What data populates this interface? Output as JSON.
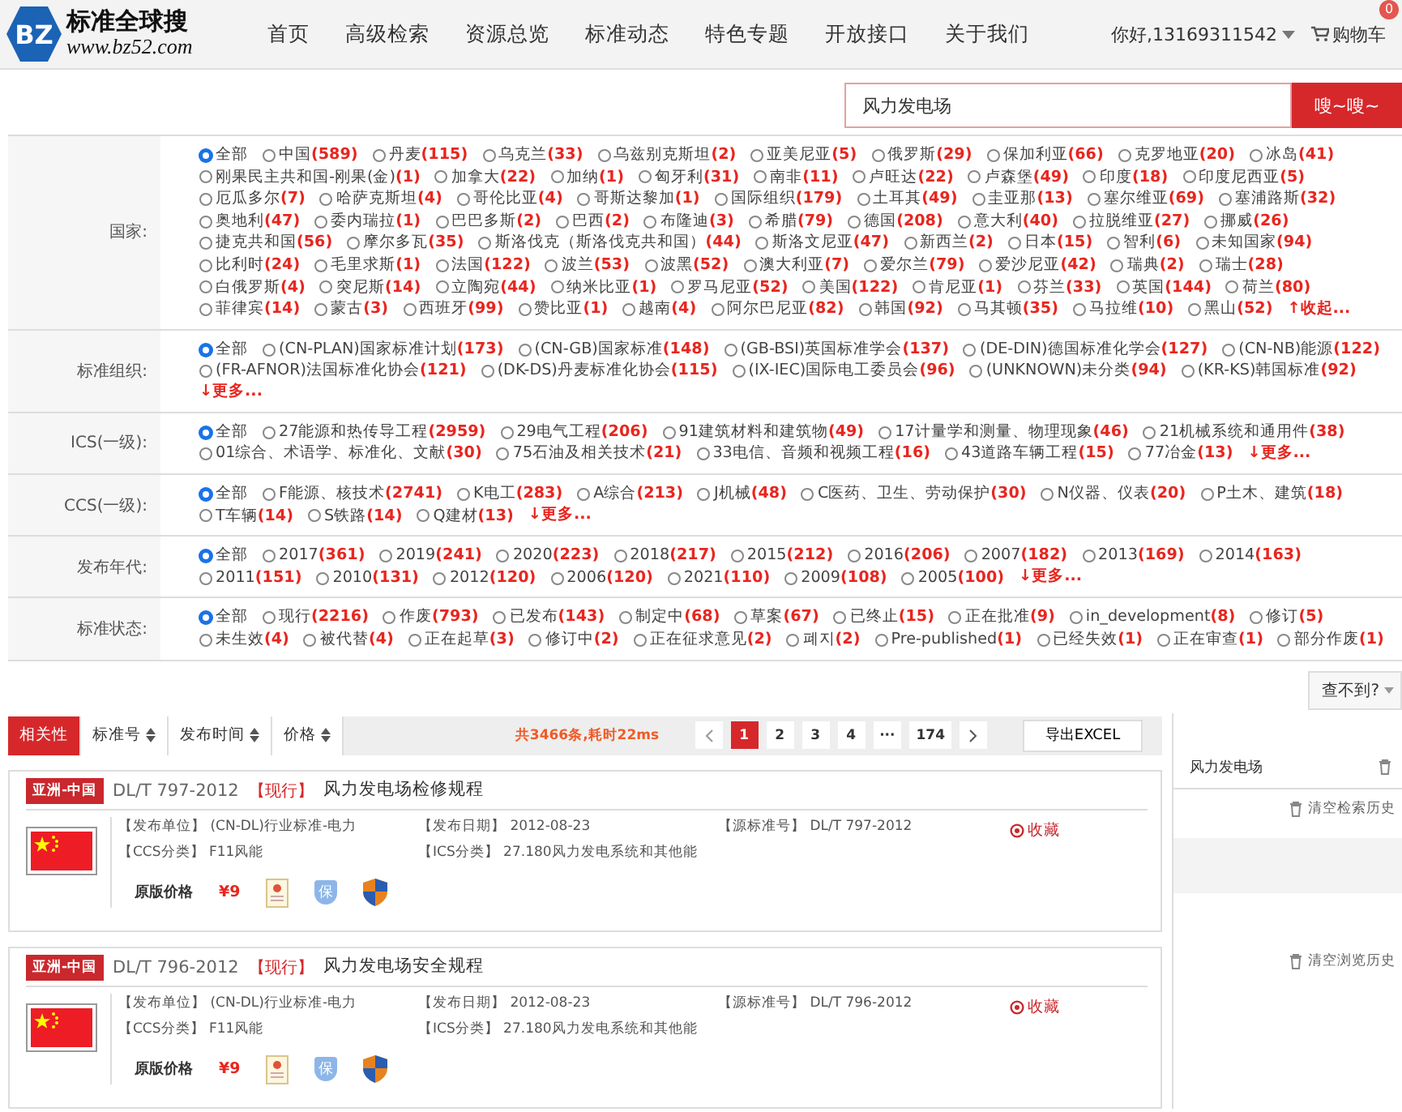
{
  "header": {
    "logo_mark": "BZ",
    "logo_title": "标准全球搜",
    "logo_url": "www.bz52.com",
    "nav": [
      {
        "label": "首页"
      },
      {
        "label": "高级检索"
      },
      {
        "label": "资源总览"
      },
      {
        "label": "标准动态"
      },
      {
        "label": "特色专题"
      },
      {
        "label": "开放接口"
      },
      {
        "label": "关于我们"
      }
    ],
    "user": "你好,13169311542",
    "cart": "购物车",
    "cart_badge": "0"
  },
  "search": {
    "value": "风力发电场",
    "button": "嗖~嗖~"
  },
  "filters": [
    {
      "label": "国家:",
      "toggle": "↑收起...",
      "options": [
        {
          "name": "全部",
          "selected": true
        },
        {
          "name": "中国",
          "count": "(589)",
          "selected": false
        },
        {
          "name": "丹麦",
          "count": "(115)",
          "selected": false
        },
        {
          "name": "乌克兰",
          "count": "(33)",
          "selected": false
        },
        {
          "name": "乌兹别克斯坦",
          "count": "(2)",
          "selected": false
        },
        {
          "name": "亚美尼亚",
          "count": "(5)",
          "selected": false
        },
        {
          "name": "俄罗斯",
          "count": "(29)",
          "selected": false
        },
        {
          "name": "保加利亚",
          "count": "(66)",
          "selected": false
        },
        {
          "name": "克罗地亚",
          "count": "(20)",
          "selected": false
        },
        {
          "name": "冰岛",
          "count": "(41)",
          "selected": false
        },
        {
          "name": "刚果民主共和国-刚果(金)",
          "count": "(1)",
          "selected": false
        },
        {
          "name": "加拿大",
          "count": "(22)",
          "selected": false
        },
        {
          "name": "加纳",
          "count": "(1)",
          "selected": false
        },
        {
          "name": "匈牙利",
          "count": "(31)",
          "selected": false
        },
        {
          "name": "南非",
          "count": "(11)",
          "selected": false
        },
        {
          "name": "卢旺达",
          "count": "(22)",
          "selected": false
        },
        {
          "name": "卢森堡",
          "count": "(49)",
          "selected": false
        },
        {
          "name": "印度",
          "count": "(18)",
          "selected": false
        },
        {
          "name": "印度尼西亚",
          "count": "(5)",
          "selected": false
        },
        {
          "name": "厄瓜多尔",
          "count": "(7)",
          "selected": false
        },
        {
          "name": "哈萨克斯坦",
          "count": "(4)",
          "selected": false
        },
        {
          "name": "哥伦比亚",
          "count": "(4)",
          "selected": false
        },
        {
          "name": "哥斯达黎加",
          "count": "(1)",
          "selected": false
        },
        {
          "name": "国际组织",
          "count": "(179)",
          "selected": false
        },
        {
          "name": "土耳其",
          "count": "(49)",
          "selected": false
        },
        {
          "name": "圭亚那",
          "count": "(13)",
          "selected": false
        },
        {
          "name": "塞尔维亚",
          "count": "(69)",
          "selected": false
        },
        {
          "name": "塞浦路斯",
          "count": "(32)",
          "selected": false
        },
        {
          "name": "奥地利",
          "count": "(47)",
          "selected": false
        },
        {
          "name": "委内瑞拉",
          "count": "(1)",
          "selected": false
        },
        {
          "name": "巴巴多斯",
          "count": "(2)",
          "selected": false
        },
        {
          "name": "巴西",
          "count": "(2)",
          "selected": false
        },
        {
          "name": "布隆迪",
          "count": "(3)",
          "selected": false
        },
        {
          "name": "希腊",
          "count": "(79)",
          "selected": false
        },
        {
          "name": "德国",
          "count": "(208)",
          "selected": false
        },
        {
          "name": "意大利",
          "count": "(40)",
          "selected": false
        },
        {
          "name": "拉脱维亚",
          "count": "(27)",
          "selected": false
        },
        {
          "name": "挪威",
          "count": "(26)",
          "selected": false
        },
        {
          "name": "捷克共和国",
          "count": "(56)",
          "selected": false
        },
        {
          "name": "摩尔多瓦",
          "count": "(35)",
          "selected": false
        },
        {
          "name": "斯洛伐克（斯洛伐克共和国）",
          "count": "(44)",
          "selected": false
        },
        {
          "name": "斯洛文尼亚",
          "count": "(47)",
          "selected": false
        },
        {
          "name": "新西兰",
          "count": "(2)",
          "selected": false
        },
        {
          "name": "日本",
          "count": "(15)",
          "selected": false
        },
        {
          "name": "智利",
          "count": "(6)",
          "selected": false
        },
        {
          "name": "未知国家",
          "count": "(94)",
          "selected": false
        },
        {
          "name": "比利时",
          "count": "(24)",
          "selected": false
        },
        {
          "name": "毛里求斯",
          "count": "(1)",
          "selected": false
        },
        {
          "name": "法国",
          "count": "(122)",
          "selected": false
        },
        {
          "name": "波兰",
          "count": "(53)",
          "selected": false
        },
        {
          "name": "波黑",
          "count": "(52)",
          "selected": false
        },
        {
          "name": "澳大利亚",
          "count": "(7)",
          "selected": false
        },
        {
          "name": "爱尔兰",
          "count": "(79)",
          "selected": false
        },
        {
          "name": "爱沙尼亚",
          "count": "(42)",
          "selected": false
        },
        {
          "name": "瑞典",
          "count": "(2)",
          "selected": false
        },
        {
          "name": "瑞士",
          "count": "(28)",
          "selected": false
        },
        {
          "name": "白俄罗斯",
          "count": "(4)",
          "selected": false
        },
        {
          "name": "突尼斯",
          "count": "(14)",
          "selected": false
        },
        {
          "name": "立陶宛",
          "count": "(44)",
          "selected": false
        },
        {
          "name": "纳米比亚",
          "count": "(1)",
          "selected": false
        },
        {
          "name": "罗马尼亚",
          "count": "(52)",
          "selected": false
        },
        {
          "name": "美国",
          "count": "(122)",
          "selected": false
        },
        {
          "name": "肯尼亚",
          "count": "(1)",
          "selected": false
        },
        {
          "name": "芬兰",
          "count": "(33)",
          "selected": false
        },
        {
          "name": "英国",
          "count": "(144)",
          "selected": false
        },
        {
          "name": "荷兰",
          "count": "(80)",
          "selected": false
        },
        {
          "name": "菲律宾",
          "count": "(14)",
          "selected": false
        },
        {
          "name": "蒙古",
          "count": "(3)",
          "selected": false
        },
        {
          "name": "西班牙",
          "count": "(99)",
          "selected": false
        },
        {
          "name": "赞比亚",
          "count": "(1)",
          "selected": false
        },
        {
          "name": "越南",
          "count": "(4)",
          "selected": false
        },
        {
          "name": "阿尔巴尼亚",
          "count": "(82)",
          "selected": false
        },
        {
          "name": "韩国",
          "count": "(92)",
          "selected": false
        },
        {
          "name": "马其顿",
          "count": "(35)",
          "selected": false
        },
        {
          "name": "马拉维",
          "count": "(10)",
          "selected": false
        },
        {
          "name": "黑山",
          "count": "(52)",
          "selected": false
        }
      ]
    },
    {
      "label": "标准组织:",
      "toggle": "↓更多...",
      "options": [
        {
          "name": "全部",
          "selected": true
        },
        {
          "name": "(CN-PLAN)国家标准计划",
          "count": "(173)",
          "selected": false
        },
        {
          "name": "(CN-GB)国家标准",
          "count": "(148)",
          "selected": false
        },
        {
          "name": "(GB-BSI)英国标准学会",
          "count": "(137)",
          "selected": false
        },
        {
          "name": "(DE-DIN)德国标准化学会",
          "count": "(127)",
          "selected": false
        },
        {
          "name": "(CN-NB)能源",
          "count": "(122)",
          "selected": false
        },
        {
          "name": "(FR-AFNOR)法国标准化协会",
          "count": "(121)",
          "selected": false
        },
        {
          "name": "(DK-DS)丹麦标准化协会",
          "count": "(115)",
          "selected": false
        },
        {
          "name": "(IX-IEC)国际电工委员会",
          "count": "(96)",
          "selected": false
        },
        {
          "name": "(UNKNOWN)未分类",
          "count": "(94)",
          "selected": false
        },
        {
          "name": "(KR-KS)韩国标准",
          "count": "(92)",
          "selected": false
        }
      ]
    },
    {
      "label": "ICS(一级):",
      "toggle": "↓更多...",
      "options": [
        {
          "name": "全部",
          "selected": true
        },
        {
          "name": "27能源和热传导工程",
          "count": "(2959)",
          "selected": false
        },
        {
          "name": "29电气工程",
          "count": "(206)",
          "selected": false
        },
        {
          "name": "91建筑材料和建筑物",
          "count": "(49)",
          "selected": false
        },
        {
          "name": "17计量学和测量、物理现象",
          "count": "(46)",
          "selected": false
        },
        {
          "name": "21机械系统和通用件",
          "count": "(38)",
          "selected": false
        },
        {
          "name": "01综合、术语学、标准化、文献",
          "count": "(30)",
          "selected": false
        },
        {
          "name": "75石油及相关技术",
          "count": "(21)",
          "selected": false
        },
        {
          "name": "33电信、音频和视频工程",
          "count": "(16)",
          "selected": false
        },
        {
          "name": "43道路车辆工程",
          "count": "(15)",
          "selected": false
        },
        {
          "name": "77冶金",
          "count": "(13)",
          "selected": false
        }
      ]
    },
    {
      "label": "CCS(一级):",
      "toggle": "↓更多...",
      "options": [
        {
          "name": "全部",
          "selected": true
        },
        {
          "name": "F能源、核技术",
          "count": "(2741)",
          "selected": false
        },
        {
          "name": "K电工",
          "count": "(283)",
          "selected": false
        },
        {
          "name": "A综合",
          "count": "(213)",
          "selected": false
        },
        {
          "name": "J机械",
          "count": "(48)",
          "selected": false
        },
        {
          "name": "C医药、卫生、劳动保护",
          "count": "(30)",
          "selected": false
        },
        {
          "name": "N仪器、仪表",
          "count": "(20)",
          "selected": false
        },
        {
          "name": "P土木、建筑",
          "count": "(18)",
          "selected": false
        },
        {
          "name": "T车辆",
          "count": "(14)",
          "selected": false
        },
        {
          "name": "S铁路",
          "count": "(14)",
          "selected": false
        },
        {
          "name": "Q建材",
          "count": "(13)",
          "selected": false
        }
      ]
    },
    {
      "label": "发布年代:",
      "toggle": "↓更多...",
      "options": [
        {
          "name": "全部",
          "selected": true
        },
        {
          "name": "2017",
          "count": "(361)",
          "selected": false
        },
        {
          "name": "2019",
          "count": "(241)",
          "selected": false
        },
        {
          "name": "2020",
          "count": "(223)",
          "selected": false
        },
        {
          "name": "2018",
          "count": "(217)",
          "selected": false
        },
        {
          "name": "2015",
          "count": "(212)",
          "selected": false
        },
        {
          "name": "2016",
          "count": "(206)",
          "selected": false
        },
        {
          "name": "2007",
          "count": "(182)",
          "selected": false
        },
        {
          "name": "2013",
          "count": "(169)",
          "selected": false
        },
        {
          "name": "2014",
          "count": "(163)",
          "selected": false
        },
        {
          "name": "2011",
          "count": "(151)",
          "selected": false
        },
        {
          "name": "2010",
          "count": "(131)",
          "selected": false
        },
        {
          "name": "2012",
          "count": "(120)",
          "selected": false
        },
        {
          "name": "2006",
          "count": "(120)",
          "selected": false
        },
        {
          "name": "2021",
          "count": "(110)",
          "selected": false
        },
        {
          "name": "2009",
          "count": "(108)",
          "selected": false
        },
        {
          "name": "2005",
          "count": "(100)",
          "selected": false
        }
      ]
    },
    {
      "label": "标准状态:",
      "options": [
        {
          "name": "全部",
          "selected": true
        },
        {
          "name": "现行",
          "count": "(2216)",
          "selected": false
        },
        {
          "name": "作废",
          "count": "(793)",
          "selected": false
        },
        {
          "name": "已发布",
          "count": "(143)",
          "selected": false
        },
        {
          "name": "制定中",
          "count": "(68)",
          "selected": false
        },
        {
          "name": "草案",
          "count": "(67)",
          "selected": false
        },
        {
          "name": "已终止",
          "count": "(15)",
          "selected": false
        },
        {
          "name": "正在批准",
          "count": "(9)",
          "selected": false
        },
        {
          "name": "in_development",
          "count": "(8)",
          "selected": false
        },
        {
          "name": "修订",
          "count": "(5)",
          "selected": false
        },
        {
          "name": "未生效",
          "count": "(4)",
          "selected": false
        },
        {
          "name": "被代替",
          "count": "(4)",
          "selected": false
        },
        {
          "name": "正在起草",
          "count": "(3)",
          "selected": false
        },
        {
          "name": "修订中",
          "count": "(2)",
          "selected": false
        },
        {
          "name": "正在征求意见",
          "count": "(2)",
          "selected": false
        },
        {
          "name": "폐지",
          "count": "(2)",
          "selected": false
        },
        {
          "name": "Pre-published",
          "count": "(1)",
          "selected": false
        },
        {
          "name": "已经失效",
          "count": "(1)",
          "selected": false
        },
        {
          "name": "正在审查",
          "count": "(1)",
          "selected": false
        },
        {
          "name": "部分作废",
          "count": "(1)",
          "selected": false
        }
      ]
    }
  ],
  "not_found": "查不到?",
  "toolbar": {
    "sorts": [
      {
        "label": "相关性",
        "selected": true
      },
      {
        "label": "标准号",
        "selected": false
      },
      {
        "label": "发布时间",
        "selected": false
      },
      {
        "label": "价格",
        "selected": false
      }
    ],
    "summary": "共3466条,耗时22ms",
    "pages": [
      {
        "label": "1",
        "selected": true
      },
      {
        "label": "2",
        "selected": false
      },
      {
        "label": "3",
        "selected": false
      },
      {
        "label": "4",
        "selected": false
      },
      {
        "label": "···",
        "selected": false
      },
      {
        "label": "174",
        "selected": false
      }
    ],
    "export": "导出EXCEL"
  },
  "results": [
    {
      "region": "亚洲-中国",
      "code": "DL/T 797-2012",
      "status": "【现行】",
      "title": "风力发电场检修规程",
      "fields": [
        {
          "label": "【发布单位】",
          "value": "(CN-DL)行业标准-电力"
        },
        {
          "label": "【发布日期】",
          "value": "2012-08-23"
        },
        {
          "label": "【源标准号】",
          "value": "DL/T 797-2012"
        },
        {
          "label": "【CCS分类】",
          "value": "F11风能"
        },
        {
          "label": "【ICS分类】",
          "value": "27.180风力发电系统和其他能"
        }
      ],
      "favorite": "收藏",
      "price_label": "原版价格",
      "price": "¥9",
      "guarantee": "保"
    },
    {
      "region": "亚洲-中国",
      "code": "DL/T 796-2012",
      "status": "【现行】",
      "title": "风力发电场安全规程",
      "fields": [
        {
          "label": "【发布单位】",
          "value": "(CN-DL)行业标准-电力"
        },
        {
          "label": "【发布日期】",
          "value": "2012-08-23"
        },
        {
          "label": "【源标准号】",
          "value": "DL/T 796-2012"
        },
        {
          "label": "【CCS分类】",
          "value": "F11风能"
        },
        {
          "label": "【ICS分类】",
          "value": "27.180风力发电系统和其他能"
        }
      ],
      "favorite": "收藏",
      "price_label": "原版价格",
      "price": "¥9",
      "guarantee": "保"
    }
  ],
  "sidebar": {
    "history": [
      {
        "label": "风力发电场"
      }
    ],
    "clear_search": "清空检索历史",
    "clear_browse": "清空浏览历史"
  }
}
